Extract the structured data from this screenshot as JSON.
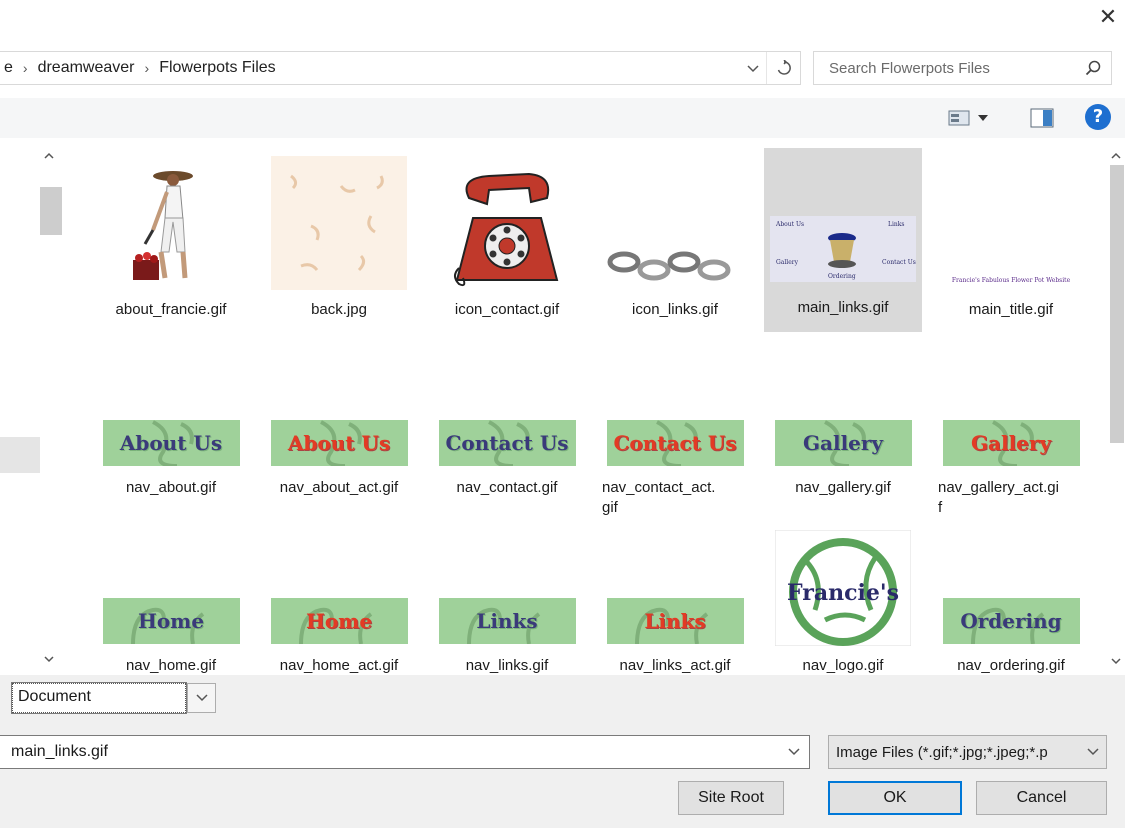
{
  "dialog": {
    "close_glyph": "✕"
  },
  "address": {
    "crumbs": [
      "e",
      "dreamweaver",
      "Flowerpots Files"
    ],
    "separator": "›",
    "dropdown_icon": "chevron-down-icon",
    "refresh_icon": "refresh-icon"
  },
  "search": {
    "placeholder": "Search Flowerpots Files",
    "icon": "search-icon"
  },
  "toolbar": {
    "view_icon": "view-options-icon",
    "pane_icon": "preview-pane-icon",
    "help_label": "?"
  },
  "files": [
    {
      "name": "about_francie.gif",
      "selected": false
    },
    {
      "name": "back.jpg",
      "selected": false
    },
    {
      "name": "icon_contact.gif",
      "selected": false
    },
    {
      "name": "icon_links.gif",
      "selected": false
    },
    {
      "name": "main_links.gif",
      "selected": true,
      "thumb_labels": [
        "About Us",
        "Links",
        "Gallery",
        "Ordering",
        "Contact Us"
      ]
    },
    {
      "name": "main_title.gif",
      "selected": false,
      "thumb_text": "Francie's Fabulous Flower Pot Website"
    },
    {
      "name": "nav_about.gif",
      "button_text": "About Us",
      "style": "dark"
    },
    {
      "name": "nav_about_act.gif",
      "button_text": "About Us",
      "style": "red"
    },
    {
      "name": "nav_contact.gif",
      "button_text": "Contact Us",
      "style": "dark"
    },
    {
      "name": "nav_contact_act.gif",
      "display_lines": [
        "nav_contact_act.",
        "gif"
      ],
      "button_text": "Contact Us",
      "style": "red"
    },
    {
      "name": "nav_gallery.gif",
      "button_text": "Gallery",
      "style": "dark"
    },
    {
      "name": "nav_gallery_act.gif",
      "display_lines": [
        "nav_gallery_act.gi",
        "f"
      ],
      "button_text": "Gallery",
      "style": "red"
    },
    {
      "name": "nav_home.gif",
      "button_text": "Home",
      "style": "dark"
    },
    {
      "name": "nav_home_act.gif",
      "button_text": "Home",
      "style": "red"
    },
    {
      "name": "nav_links.gif",
      "button_text": "Links",
      "style": "dark"
    },
    {
      "name": "nav_links_act.gif",
      "button_text": "Links",
      "style": "red"
    },
    {
      "name": "nav_logo.gif",
      "logo_text": "Francie's"
    },
    {
      "name": "nav_ordering.gif",
      "button_text": "Ordering",
      "style": "dark"
    }
  ],
  "bottom": {
    "relative_to": "Document",
    "filename_value": "main_links.gif",
    "file_type": "Image Files (*.gif;*.jpg;*.jpeg;*.p",
    "site_root_label": "Site Root",
    "ok_label": "OK",
    "cancel_label": "Cancel"
  }
}
